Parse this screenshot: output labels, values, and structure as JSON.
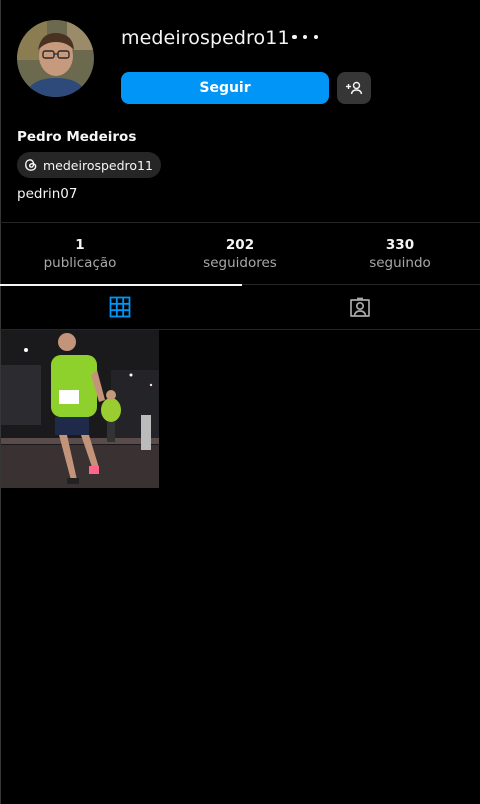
{
  "profile": {
    "username": "medeirospedro11",
    "full_name": "Pedro Medeiros",
    "threads_handle": "medeirospedro11",
    "bio": "pedrin07",
    "follow_label": "Seguir"
  },
  "stats": [
    {
      "count": "1",
      "label": "publicação"
    },
    {
      "count": "202",
      "label": "seguidores"
    },
    {
      "count": "330",
      "label": "seguindo"
    }
  ],
  "tabs": [
    {
      "icon": "grid-icon",
      "active": true
    },
    {
      "icon": "tagged-icon",
      "active": false
    }
  ],
  "colors": {
    "accent": "#0095f6",
    "background": "#000000",
    "secondary_button": "#363636",
    "muted_text": "#a8a8a8"
  },
  "icons": {
    "more": "more-options-icon",
    "suggest": "add-person-icon",
    "threads": "threads-icon"
  }
}
